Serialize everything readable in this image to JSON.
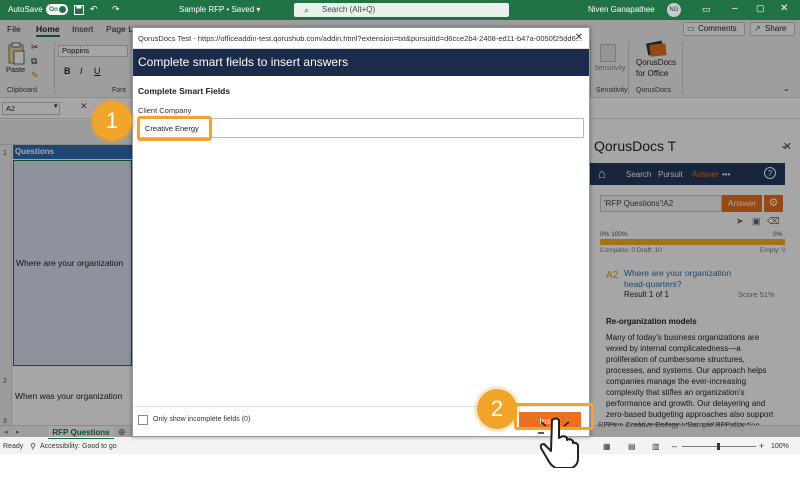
{
  "titlebar": {
    "autosave_label": "AutoSave",
    "autosave_state": "On",
    "doc_title": "Sample RFP",
    "save_state": "Saved",
    "search_placeholder": "Search (Alt+Q)",
    "user_name": "Niven Ganapathee",
    "user_initials": "NG"
  },
  "tabs": [
    "File",
    "Home",
    "Insert",
    "Page La"
  ],
  "toolbar": {
    "comments_label": "Comments",
    "share_label": "Share"
  },
  "ribbon": {
    "paste_label": "Paste",
    "clipboard_label": "Clipboard",
    "font_name": "Poppins",
    "font_group_label": "Font",
    "sensitivity_label": "Sensitivity",
    "sensitivity_group": "Sensitivity",
    "qorus_button_line1": "QorusDocs",
    "qorus_button_line2": "for Office",
    "qorus_group": "QorusDocs",
    "bold": "B",
    "italic": "I"
  },
  "formula_bar": {
    "name_box": "A2"
  },
  "grid": {
    "rows": [
      "1",
      "2",
      "3"
    ],
    "header_cell": "Questions",
    "a2": "Where are your organization",
    "a3": "When was your organization"
  },
  "sheet": {
    "tab_name": "RFP Questions",
    "status_ready": "Ready",
    "status_accessibility": "Accessibility: Good to go",
    "zoom": "100%"
  },
  "pane": {
    "title": "QorusDocs T",
    "nav": [
      "Search",
      "Pursuit",
      "Answer",
      "•••"
    ],
    "input_value": "'RFP Questions'!A2",
    "answer_button": "Answer",
    "progress_left": "0% 100%",
    "progress_right": "0%",
    "progress_sub_left": "Complete: 0  Draft: 10",
    "progress_sub_right": "Empty: 0",
    "progress_fill": 1.0,
    "question_ref": "A2",
    "question_text": "Where are your organization head-quarters?",
    "result_label": "Result 1 of 1",
    "score_label": "Score 51%",
    "card_title": "Re-organization models",
    "card_body": "Many of today's business organizations are vexed by internal complicatedness—a proliferation of cumbersome structures, processes, and systems. Our approach helps companies manage the ever-increasing complexity that stifles an organization's performance and growth. Our delayering and zero-based budgeting approaches also support large-scale transformation and organization change by freeing up resources to drive growth",
    "breadcrumb": "RFPs > Creative Energy > Sample RFP.xlsx"
  },
  "dialog": {
    "url": "QorusDocs Test - https://officeaddin-test.qorushub.com/addin.html?extension=txt&pursuitId=d6cce2b4-2408-ed11-b47a-0050f25dd6...",
    "header": "Complete smart fields to insert answers",
    "section_title": "Complete Smart Fields",
    "field_label": "Client Company",
    "field_value": "Creative Energy",
    "checkbox_label": "Only show incomplete fields",
    "checkbox_count": "(0)",
    "insert_label": "Insert"
  },
  "steps": [
    "1",
    "2"
  ],
  "colors": {
    "excel_green": "#217346",
    "qorus_navy": "#1a2b4b",
    "accent_orange": "#e8701f",
    "callout_gold": "#f0a52a"
  }
}
